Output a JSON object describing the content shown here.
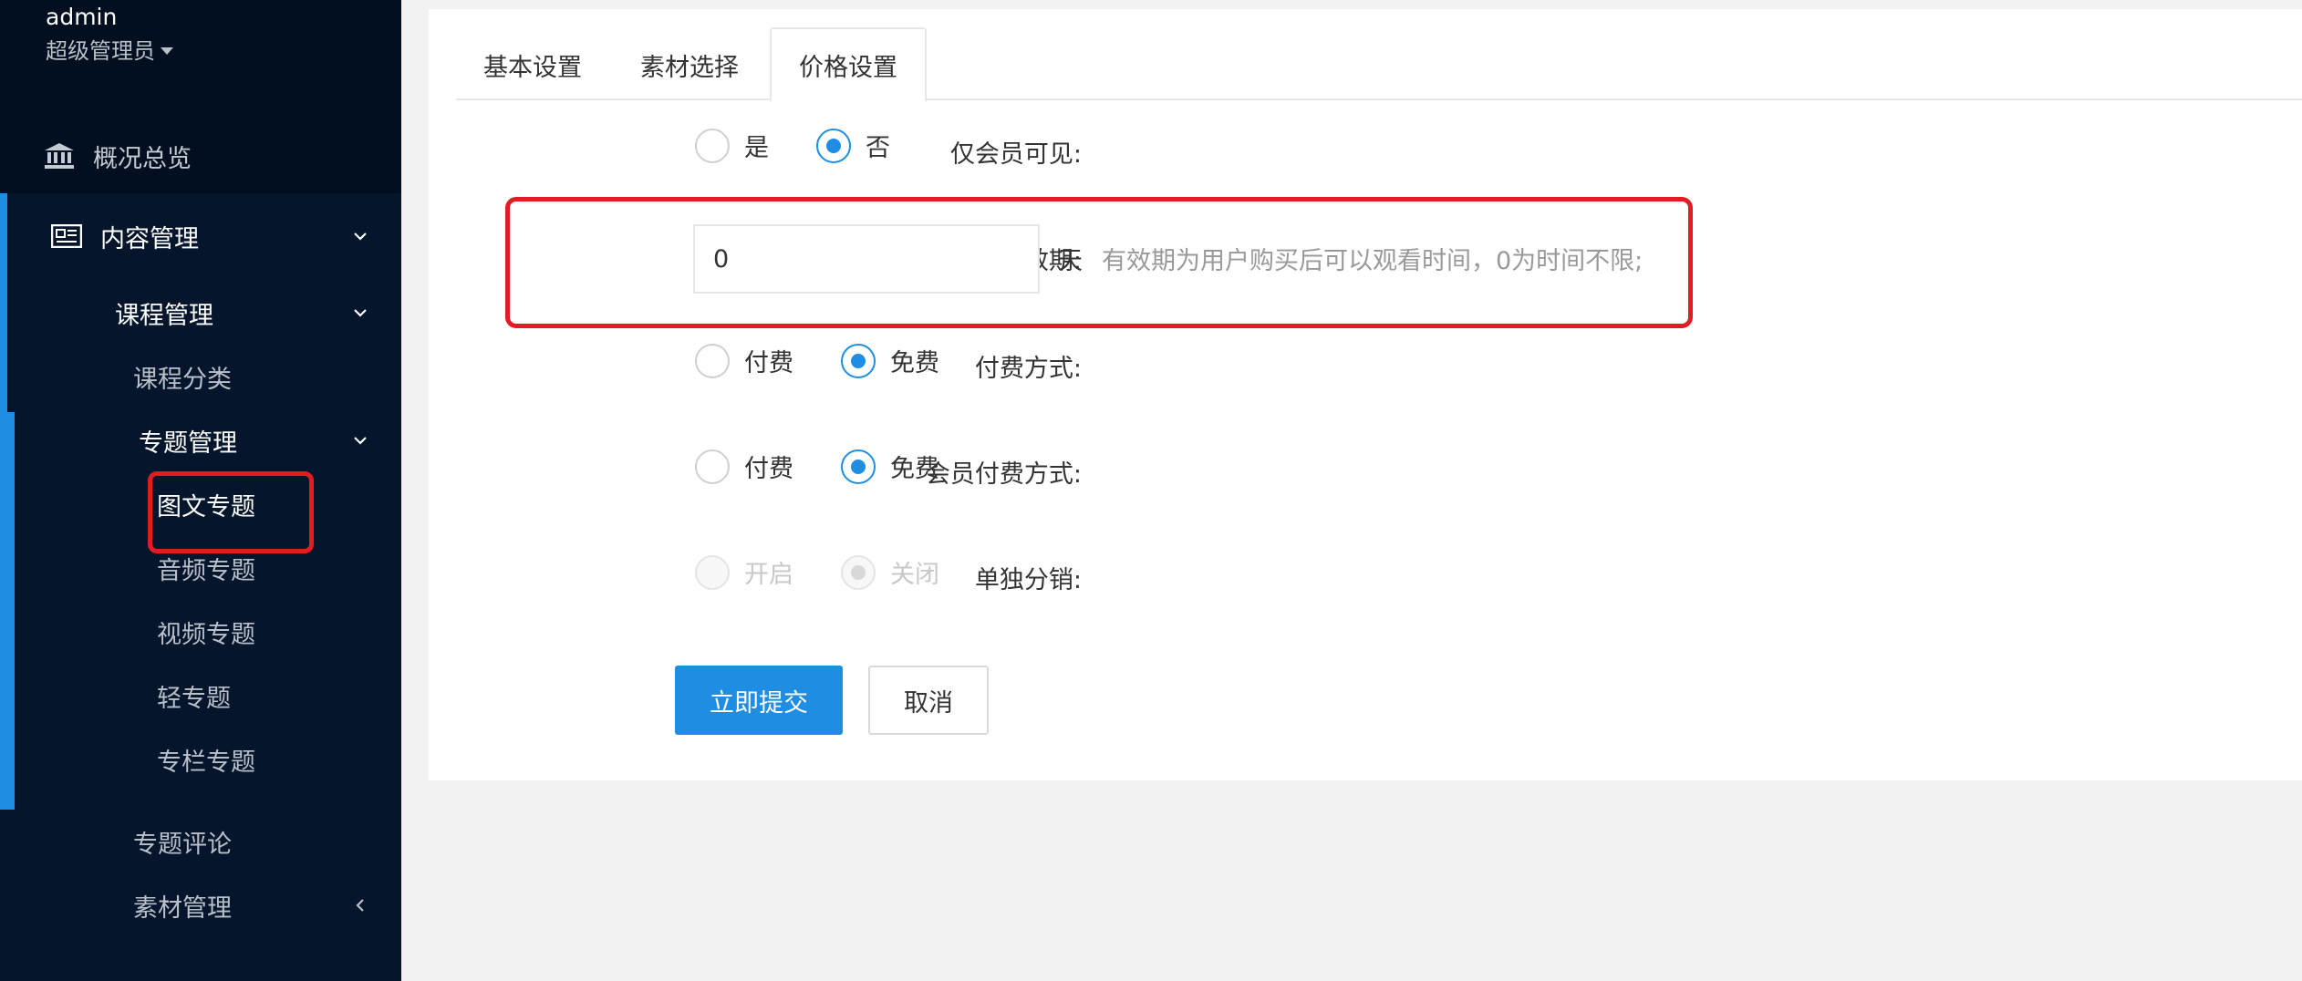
{
  "sidebar": {
    "username": "admin",
    "role": "超级管理员",
    "overview_label": "概况总览",
    "content_label": "内容管理",
    "course_label": "课程管理",
    "course_category": "课程分类",
    "topic_label": "专题管理",
    "topic_items": [
      "图文专题",
      "音频专题",
      "视频专题",
      "轻专题",
      "专栏专题"
    ],
    "topic_comment": "专题评论",
    "material_label": "素材管理"
  },
  "tabs": [
    "基本设置",
    "素材选择",
    "价格设置"
  ],
  "form": {
    "member_only": {
      "label": "仅会员可见:",
      "options": [
        "是",
        "否"
      ],
      "selected": "否"
    },
    "validity": {
      "label": "有效期:",
      "value": "0",
      "unit": "天",
      "hint": "有效期为用户购买后可以观看时间，0为时间不限;"
    },
    "pay_type": {
      "label": "付费方式:",
      "options": [
        "付费",
        "免费"
      ],
      "selected": "免费"
    },
    "member_pay_type": {
      "label": "会员付费方式:",
      "options": [
        "付费",
        "免费"
      ],
      "selected": "免费"
    },
    "distribution": {
      "label": "单独分销:",
      "options": [
        "开启",
        "关闭"
      ],
      "selected": "关闭",
      "disabled": true
    }
  },
  "buttons": {
    "submit": "立即提交",
    "cancel": "取消"
  },
  "colors": {
    "sidebar_bg": "#020f20",
    "accent": "#1f8ee2",
    "annotation_red": "#e31b23"
  }
}
